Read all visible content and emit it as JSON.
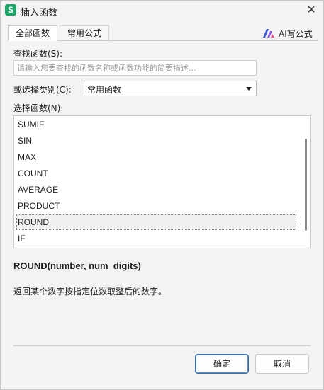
{
  "window": {
    "title": "插入函数",
    "app_icon_letter": "S",
    "close_glyph": "✕"
  },
  "tabs": [
    {
      "label": "全部函数",
      "active": true
    },
    {
      "label": "常用公式",
      "active": false
    }
  ],
  "ai_link": {
    "label": "AI写公式",
    "icon": "ai-logo-icon"
  },
  "search": {
    "label": "查找函数(S):",
    "placeholder": "请输入您要查找的函数名称或函数功能的简要描述..."
  },
  "category": {
    "label": "或选择类别(C):",
    "selected": "常用函数"
  },
  "function_list": {
    "label": "选择函数(N):",
    "items": [
      "SUMIF",
      "SIN",
      "MAX",
      "COUNT",
      "AVERAGE",
      "PRODUCT",
      "ROUND",
      "IF"
    ],
    "selected": "ROUND"
  },
  "details": {
    "syntax": "ROUND(number, num_digits)",
    "description": "返回某个数字按指定位数取整后的数字。"
  },
  "buttons": {
    "ok": "确定",
    "cancel": "取消"
  },
  "colors": {
    "app_icon": "#1aa365",
    "primary_border": "#3a6ea5"
  }
}
